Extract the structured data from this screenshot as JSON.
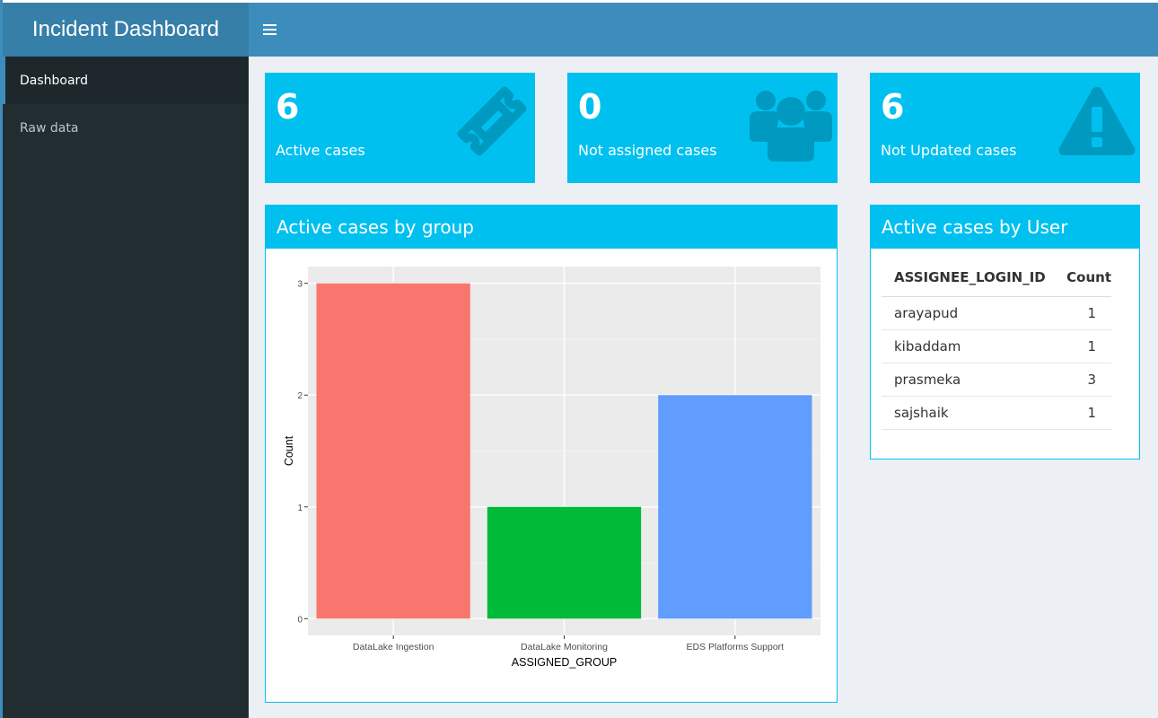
{
  "app": {
    "title": "Incident Dashboard"
  },
  "sidebar": {
    "items": [
      {
        "label": "Dashboard",
        "active": true
      },
      {
        "label": "Raw data",
        "active": false
      }
    ]
  },
  "value_boxes": [
    {
      "value": "6",
      "label": "Active cases",
      "icon": "ticket-icon"
    },
    {
      "value": "0",
      "label": "Not assigned cases",
      "icon": "users-icon"
    },
    {
      "value": "6",
      "label": "Not Updated cases",
      "icon": "warning-icon"
    }
  ],
  "group_panel": {
    "title": "Active cases by group"
  },
  "user_panel": {
    "title": "Active cases by User",
    "columns": [
      "ASSIGNEE_LOGIN_ID",
      "Count"
    ],
    "rows": [
      [
        "arayapud",
        "1"
      ],
      [
        "kibaddam",
        "1"
      ],
      [
        "prasmeka",
        "3"
      ],
      [
        "sajshaik",
        "1"
      ]
    ]
  },
  "colors": {
    "accent": "#00c0ef",
    "header": "#3c8dbc",
    "logo": "#367fa9",
    "sidebar": "#222d32"
  },
  "chart_data": {
    "type": "bar",
    "categories": [
      "DataLake Ingestion",
      "DataLake Monitoring",
      "EDS Platforms Support"
    ],
    "values": [
      3,
      1,
      2
    ],
    "colors": [
      "#f8766d",
      "#00ba38",
      "#619cff"
    ],
    "xlabel": "ASSIGNED_GROUP",
    "ylabel": "Count",
    "ylim": [
      0,
      3
    ],
    "yticks": [
      0,
      1,
      2,
      3
    ],
    "grid": true,
    "legend": "none"
  }
}
